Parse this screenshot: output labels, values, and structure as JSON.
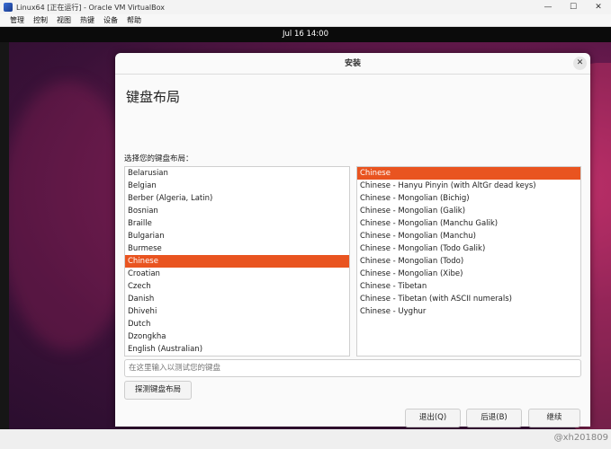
{
  "host": {
    "title": "Linux64 [正在运行] - Oracle VM VirtualBox",
    "menu": [
      "管理",
      "控制",
      "视图",
      "热键",
      "设备",
      "帮助"
    ],
    "window_buttons": [
      "—",
      "☐",
      "✕"
    ]
  },
  "guest": {
    "clock": "Jul 16  14:00"
  },
  "dialog": {
    "header": "安装",
    "close_glyph": "✕",
    "title": "键盘布局",
    "prompt": "选择您的键盘布局：",
    "layouts": [
      "Belarusian",
      "Belgian",
      "Berber (Algeria, Latin)",
      "Bosnian",
      "Braille",
      "Bulgarian",
      "Burmese",
      "Chinese",
      "Croatian",
      "Czech",
      "Danish",
      "Dhivehi",
      "Dutch",
      "Dzongkha",
      "English (Australian)"
    ],
    "selected_layout": "Chinese",
    "variants": [
      "Chinese",
      "Chinese - Hanyu Pinyin (with AltGr dead keys)",
      "Chinese - Mongolian (Bichig)",
      "Chinese - Mongolian (Galik)",
      "Chinese - Mongolian (Manchu Galik)",
      "Chinese - Mongolian (Manchu)",
      "Chinese - Mongolian (Todo Galik)",
      "Chinese - Mongolian (Todo)",
      "Chinese - Mongolian (Xibe)",
      "Chinese - Tibetan",
      "Chinese - Tibetan (with ASCII numerals)",
      "Chinese - Uyghur"
    ],
    "selected_variant": "Chinese",
    "test_placeholder": "在这里输入以测试您的键盘",
    "detect_button": "探测键盘布局",
    "quit_button": "退出(Q)",
    "back_button": "后退(B)",
    "continue_button": "继续"
  },
  "statusbar": {
    "watermark": "@xh201809"
  },
  "colors": {
    "accent": "#e95420"
  }
}
